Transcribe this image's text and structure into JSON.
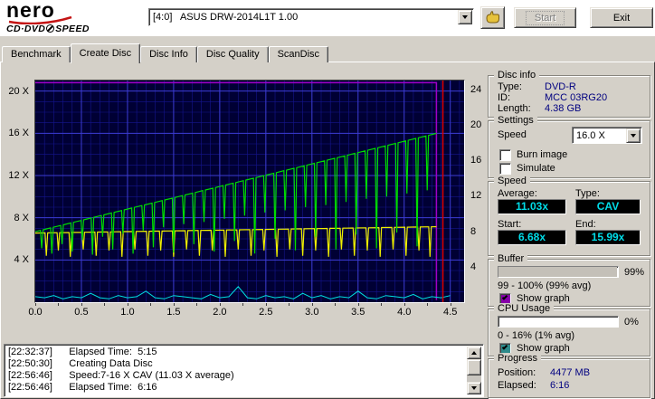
{
  "topbar": {
    "logo": {
      "brand": "nero",
      "product_left": "CD·DVD",
      "product_right": "SPEED"
    },
    "drive_select_value": "[4:0]   ASUS DRW-2014L1T 1.00",
    "start_label": "Start",
    "exit_label": "Exit"
  },
  "tabs": [
    {
      "label": "Benchmark"
    },
    {
      "label": "Create Disc"
    },
    {
      "label": "Disc Info"
    },
    {
      "label": "Disc Quality"
    },
    {
      "label": "ScanDisc"
    }
  ],
  "active_tab": "Create Disc",
  "chart_data": {
    "type": "line",
    "x_label_unit": "GB",
    "x_max": 4.65,
    "y_left_max": 21,
    "y_right_max": 25,
    "x_ticks": [
      0.0,
      0.5,
      1.0,
      1.5,
      2.0,
      2.5,
      3.0,
      3.5,
      4.0,
      4.5
    ],
    "y_left_ticks": [
      {
        "v": 4,
        "label": "4 X"
      },
      {
        "v": 8,
        "label": "8 X"
      },
      {
        "v": 12,
        "label": "12 X"
      },
      {
        "v": 16,
        "label": "16 X"
      },
      {
        "v": 20,
        "label": "20 X"
      }
    ],
    "y_right_ticks": [
      {
        "v": 4,
        "label": "4"
      },
      {
        "v": 8,
        "label": "8"
      },
      {
        "v": 12,
        "label": "12"
      },
      {
        "v": 16,
        "label": "16"
      },
      {
        "v": 20,
        "label": "20"
      },
      {
        "v": 24,
        "label": "24"
      }
    ],
    "colors": {
      "plot_bg": "#000034",
      "grid_fine": "#15158e",
      "grid_major": "#3c3cd2"
    },
    "series": {
      "write_speed": {
        "name": "Write speed (green)",
        "color": "#00dc00",
        "start_x": 0,
        "base_start": 6.68,
        "end_x": 4.35,
        "base_end": 15.99,
        "dips": [
          [
            0.07,
            5.1
          ],
          [
            0.18,
            4.6
          ],
          [
            0.29,
            5.5
          ],
          [
            0.4,
            4.8
          ],
          [
            0.51,
            5.9
          ],
          [
            0.62,
            4.5
          ],
          [
            0.73,
            6.2
          ],
          [
            0.84,
            5.0
          ],
          [
            0.95,
            6.5
          ],
          [
            1.06,
            4.6
          ],
          [
            1.17,
            6.8
          ],
          [
            1.28,
            5.2
          ],
          [
            1.39,
            7.1
          ],
          [
            1.5,
            4.7
          ],
          [
            1.61,
            7.4
          ],
          [
            1.72,
            5.5
          ],
          [
            1.83,
            7.6
          ],
          [
            1.94,
            4.8
          ],
          [
            2.05,
            7.9
          ],
          [
            2.16,
            5.8
          ],
          [
            2.27,
            8.2
          ],
          [
            2.38,
            4.6
          ],
          [
            2.49,
            8.5
          ],
          [
            2.6,
            6.0
          ],
          [
            2.71,
            8.7
          ],
          [
            2.82,
            4.9
          ],
          [
            2.93,
            9.0
          ],
          [
            3.04,
            6.2
          ],
          [
            3.15,
            9.2
          ],
          [
            3.26,
            5.0
          ],
          [
            3.37,
            9.5
          ],
          [
            3.48,
            6.4
          ],
          [
            3.59,
            9.8
          ],
          [
            3.7,
            5.1
          ],
          [
            3.81,
            10.0
          ],
          [
            3.92,
            6.6
          ],
          [
            4.03,
            10.3
          ],
          [
            4.14,
            5.3
          ],
          [
            4.25,
            10.6
          ]
        ]
      },
      "secondary_speed": {
        "name": "Secondary speed (yellow)",
        "color": "#f0f000",
        "start_x": 0,
        "base_start": 6.55,
        "end_x": 4.35,
        "base_end": 7.15,
        "dips": [
          [
            0.12,
            4.4
          ],
          [
            0.25,
            4.9
          ],
          [
            0.38,
            4.3
          ],
          [
            0.52,
            5.0
          ],
          [
            0.66,
            4.4
          ],
          [
            0.8,
            4.9
          ],
          [
            0.94,
            4.3
          ],
          [
            1.08,
            5.0
          ],
          [
            1.22,
            4.4
          ],
          [
            1.36,
            4.9
          ],
          [
            1.5,
            4.3
          ],
          [
            1.64,
            5.0
          ],
          [
            1.78,
            4.4
          ],
          [
            1.92,
            4.9
          ],
          [
            2.06,
            4.3
          ],
          [
            2.2,
            5.0
          ],
          [
            2.34,
            4.4
          ],
          [
            2.48,
            4.9
          ],
          [
            2.62,
            4.3
          ],
          [
            2.76,
            5.0
          ],
          [
            2.9,
            4.4
          ],
          [
            3.04,
            4.9
          ],
          [
            3.18,
            4.3
          ],
          [
            3.32,
            5.0
          ],
          [
            3.46,
            4.4
          ],
          [
            3.6,
            4.9
          ],
          [
            3.74,
            4.3
          ],
          [
            3.88,
            5.0
          ],
          [
            4.02,
            4.4
          ],
          [
            4.16,
            4.9
          ],
          [
            4.28,
            4.3
          ]
        ]
      },
      "cpu_usage": {
        "name": "CPU usage % (cyan)",
        "color": "#00e0e0",
        "step": 0.1,
        "values": [
          2.5,
          2,
          3,
          1.5,
          2.5,
          2,
          4,
          2,
          1.5,
          3,
          2,
          2.5,
          5,
          2,
          1.5,
          3,
          2.5,
          2,
          1.5,
          3.5,
          2,
          2.5,
          7,
          2,
          1.5,
          3,
          2,
          2.5,
          1.5,
          4,
          2,
          3,
          1.5,
          2.5,
          2,
          5,
          2,
          1.5,
          3,
          2.5,
          2,
          3.5,
          1.5,
          2.5,
          2,
          3
        ]
      },
      "buffer": {
        "name": "Buffer level % (purple)",
        "color": "#a000c8",
        "points": [
          [
            0,
            99
          ],
          [
            4.35,
            99
          ],
          [
            4.35,
            1
          ]
        ]
      },
      "end_marker": {
        "name": "End position (red)",
        "color": "#dc0000",
        "x": 4.42
      }
    }
  },
  "disc_info": {
    "title": "Disc info",
    "rows": [
      {
        "label": "Type:",
        "value": "DVD-R"
      },
      {
        "label": "ID:",
        "value": "MCC 03RG20"
      },
      {
        "label": "Length:",
        "value": "4.38 GB"
      }
    ]
  },
  "settings": {
    "title": "Settings",
    "speed_label": "Speed",
    "speed_value": "16.0 X",
    "burn_image_label": "Burn image",
    "simulate_label": "Simulate"
  },
  "speed_panel": {
    "title": "Speed",
    "average_label": "Average:",
    "average_value": "11.03x",
    "type_label": "Type:",
    "type_value": "CAV",
    "start_label": "Start:",
    "start_value": "6.68x",
    "end_label": "End:",
    "end_value": "15.99x"
  },
  "buffer_panel": {
    "title": "Buffer",
    "percent": "99%",
    "range": "99 - 100% (99% avg)",
    "show_graph_label": "Show graph",
    "fill_pct": 99,
    "graph_color": "#8800aa"
  },
  "cpu_panel": {
    "title": "CPU Usage",
    "percent": "0%",
    "range": "0 - 16% (1% avg)",
    "show_graph_label": "Show graph",
    "fill_pct": 0,
    "graph_color": "#2e8b8b"
  },
  "progress_panel": {
    "title": "Progress",
    "position_label": "Position:",
    "position_value": "4477 MB",
    "elapsed_label": "Elapsed:",
    "elapsed_value": "6:16"
  },
  "log": [
    "[22:32:37]      Elapsed Time:  5:15",
    "[22:50:30]      Creating Data Disc",
    "[22:56:46]      Speed:7-16 X CAV (11.03 X average)",
    "[22:56:46]      Elapsed Time:  6:16"
  ]
}
